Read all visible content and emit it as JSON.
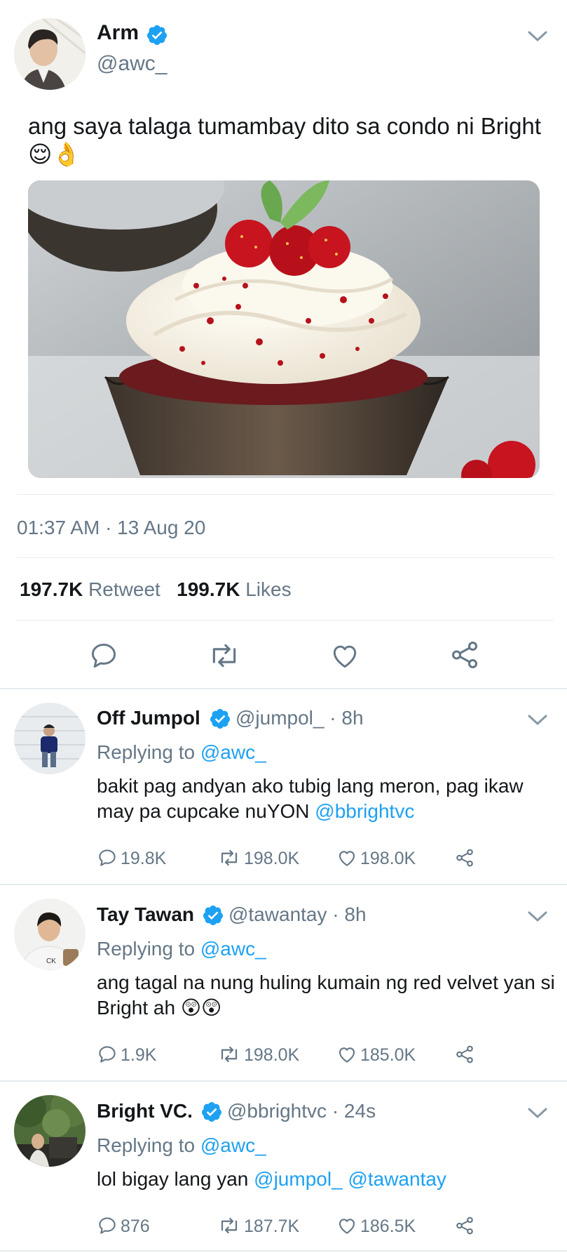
{
  "main_tweet": {
    "name": "Arm",
    "handle": "@awc_",
    "text": "ang saya talaga tumambay dito sa condo ni Bright 😌👌",
    "timestamp": "01:37 AM · 13 Aug 20",
    "retweet_count": "197.7K",
    "retweet_label": "Retweet",
    "likes_count": "199.7K",
    "likes_label": "Likes"
  },
  "replies": [
    {
      "name": "Off Jumpol",
      "handle": "@jumpol_",
      "time": "· 8h",
      "replying_label": "Replying to",
      "replying_to": "@awc_",
      "text": "bakit pag andyan ako tubig lang meron, pag ikaw may pa cupcake nuYON",
      "mention": "@bbrightvc",
      "replies": "19.8K",
      "retweets": "198.0K",
      "likes": "198.0K"
    },
    {
      "name": "Tay Tawan",
      "handle": "@tawantay",
      "time": "· 8h",
      "replying_label": "Replying to",
      "replying_to": "@awc_",
      "text": "ang tagal na nung huling kumain ng red velvet yan si Bright ah 😲😲",
      "replies": "1.9K",
      "retweets": "198.0K",
      "likes": "185.0K"
    },
    {
      "name": "Bright VC.",
      "handle": "@bbrightvc",
      "time": "· 24s",
      "replying_label": "Replying to",
      "replying_to": "@awc_",
      "text": "lol bigay lang yan",
      "mention1": "@jumpol_",
      "mention2": "@tawantay",
      "replies": "876",
      "retweets": "187.7K",
      "likes": "186.5K"
    }
  ],
  "icons": {
    "verified": "verified-badge-icon",
    "chevron": "chevron-down-icon",
    "reply": "reply-icon",
    "retweet": "retweet-icon",
    "like": "heart-icon",
    "share": "share-icon"
  },
  "colors": {
    "accent": "#1da1f2",
    "text": "#14171a",
    "secondary": "#657786",
    "divider": "#e6ecf0"
  }
}
